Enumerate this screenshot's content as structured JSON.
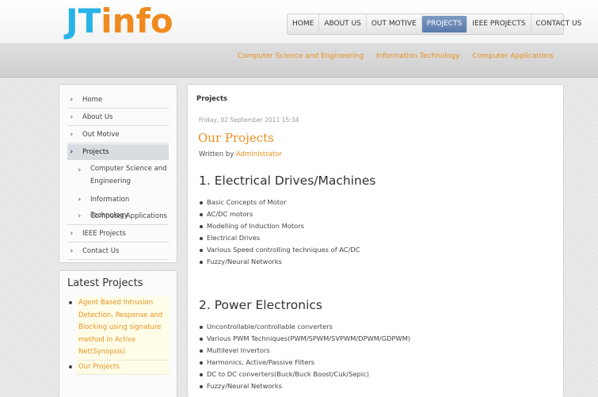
{
  "logo": {
    "part1": "JT",
    "part2": "info"
  },
  "main_nav": [
    "HOME",
    "ABOUT US",
    "OUT MOTIVE",
    "PROJECTS",
    "IEEE PROJECTS",
    "CONTACT US"
  ],
  "main_nav_active": "PROJECTS",
  "sub_nav": [
    "Computer Science and Engineering",
    "Information Technology",
    "Computer Applications"
  ],
  "sidebar": {
    "home": "Home",
    "about": "About Us",
    "motive": "Out Motive",
    "projects": "Projects",
    "cse_line1": "Computer Science and",
    "cse_line2": "Engineering",
    "it": "Information Technology",
    "ca": "Computer Applications",
    "ieee": "IEEE Projects",
    "contact": "Contact Us"
  },
  "latest": {
    "title": "Latest Projects",
    "items": [
      "Agent Based Intrusion Detection, Response and Blocking using signature method in Active Net(Synopsis)",
      "Our Projects"
    ]
  },
  "content": {
    "breadcrumb": "Projects",
    "date": "Friday, 02 September 2011 15:34",
    "title": "Our Projects",
    "written_by": "Written by",
    "author": "Administrator",
    "sections": [
      {
        "heading": "1. Electrical Drives/Machines",
        "items": [
          "Basic Concepts of Motor",
          "AC/DC motors",
          "Modelling of Induction Motors",
          "Electrical Drives",
          "Various Speed controlling techniques of AC/DC",
          "Fuzzy/Neural Networks"
        ]
      },
      {
        "heading": "2. Power Electronics",
        "items": [
          "Uncontrollable/controllable converters",
          "Various PWM Techniques(PWM/SPWM/SVPWM/DPWM/GDPWM)",
          "Multilevel Invertors",
          "Harmonics, Active/Passive Filters",
          "DC to DC converters(Buck/Buck Boost/Cuk/Sepic)",
          "Fuzzy/Neural Networks"
        ]
      }
    ]
  },
  "colors": {
    "accent": "#e8901f",
    "logo_blue": "#27b3e6",
    "nav_active": "#5a7aab"
  }
}
